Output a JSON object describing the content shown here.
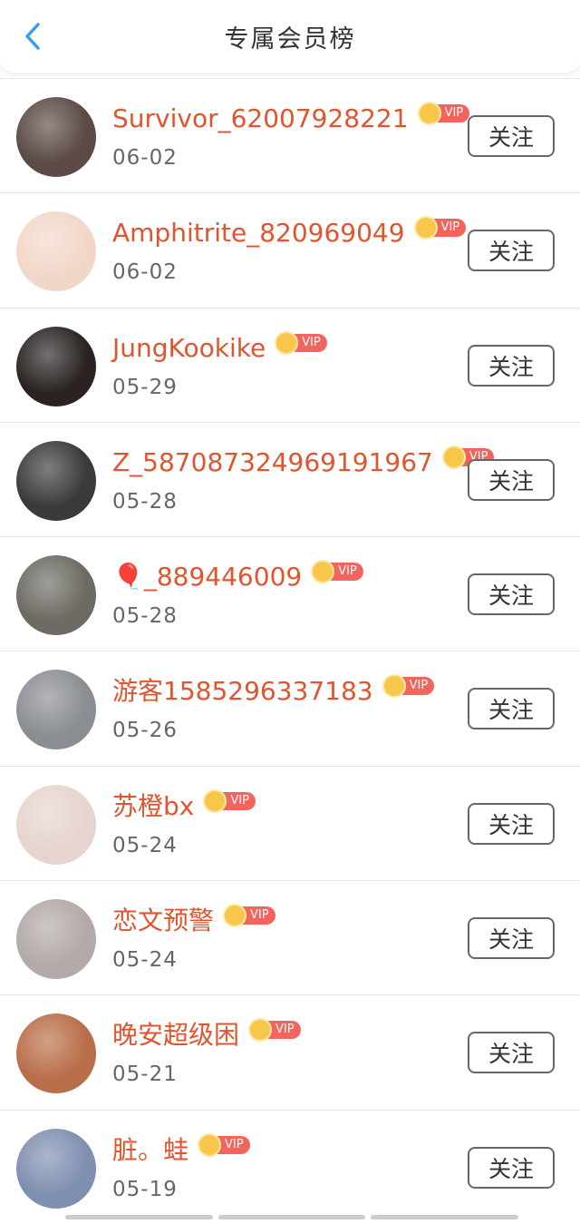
{
  "header": {
    "title": "专属会员榜",
    "back_icon": "chevron-left-icon"
  },
  "colors": {
    "accent": "#3a9ee8",
    "name": "#e0552e",
    "vip": "#f2645d",
    "crown": "#f7c64b"
  },
  "vip_label": "VIP",
  "follow_label": "关注",
  "members": [
    {
      "name": "Survivor_62007928221",
      "date": "06-02",
      "avatar_bg": "#5b4a45"
    },
    {
      "name": "Amphitrite_820969049",
      "date": "06-02",
      "avatar_bg": "#f2d7c9"
    },
    {
      "name": "JungKookike",
      "date": "05-29",
      "avatar_bg": "#2a2322"
    },
    {
      "name": "Z_587087324969191967",
      "date": "05-28",
      "avatar_bg": "#3a3a3a"
    },
    {
      "name": "🎈_889446009",
      "date": "05-28",
      "avatar_bg": "#6c6a62"
    },
    {
      "name": "游客1585296337183",
      "date": "05-26",
      "avatar_bg": "#8a8d92"
    },
    {
      "name": "苏橙bx",
      "date": "05-24",
      "avatar_bg": "#e6d4cf"
    },
    {
      "name": "恋文预警",
      "date": "05-24",
      "avatar_bg": "#b2a9a8"
    },
    {
      "name": "晚安超级困",
      "date": "05-21",
      "avatar_bg": "#b86e48"
    },
    {
      "name": "脏。蛙",
      "date": "05-19",
      "avatar_bg": "#7f8fb0"
    }
  ]
}
